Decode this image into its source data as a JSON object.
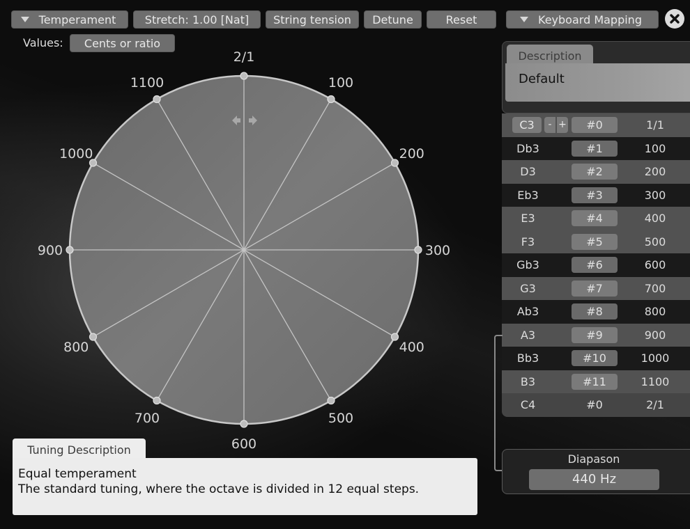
{
  "toolbar": {
    "temperament_label": "Temperament",
    "stretch_label": "Stretch: 1.00 [Nat]",
    "string_tension_label": "String tension",
    "detune_label": "Detune",
    "reset_label": "Reset",
    "keyboard_mapping_label": "Keyboard Mapping",
    "close_icon": "close-icon"
  },
  "values": {
    "label": "Values:",
    "mode": "Cents or ratio"
  },
  "chart_data": {
    "type": "radial-tuning-wheel",
    "title": "",
    "steps": 12,
    "unit": "cents",
    "range": [
      0,
      1200
    ],
    "points": [
      {
        "label": "2/1",
        "cents": 0
      },
      {
        "label": "100",
        "cents": 100
      },
      {
        "label": "200",
        "cents": 200
      },
      {
        "label": "300",
        "cents": 300
      },
      {
        "label": "400",
        "cents": 400
      },
      {
        "label": "500",
        "cents": 500
      },
      {
        "label": "600",
        "cents": 600
      },
      {
        "label": "700",
        "cents": 700
      },
      {
        "label": "800",
        "cents": 800
      },
      {
        "label": "900",
        "cents": 900
      },
      {
        "label": "1000",
        "cents": 1000
      },
      {
        "label": "1100",
        "cents": 1100
      }
    ],
    "rotate_handle_icon": "left-right-arrows-icon"
  },
  "description": {
    "tab_label": "Description",
    "value": "Default"
  },
  "mapping_table": {
    "rows": [
      {
        "note": "C3",
        "key": "#0",
        "value": "1/1",
        "shade": "light",
        "editable": true
      },
      {
        "note": "Db3",
        "key": "#1",
        "value": "100",
        "shade": "dark"
      },
      {
        "note": "D3",
        "key": "#2",
        "value": "200",
        "shade": "light"
      },
      {
        "note": "Eb3",
        "key": "#3",
        "value": "300",
        "shade": "dark"
      },
      {
        "note": "E3",
        "key": "#4",
        "value": "400",
        "shade": "light"
      },
      {
        "note": "F3",
        "key": "#5",
        "value": "500",
        "shade": "light"
      },
      {
        "note": "Gb3",
        "key": "#6",
        "value": "600",
        "shade": "dark"
      },
      {
        "note": "G3",
        "key": "#7",
        "value": "700",
        "shade": "light"
      },
      {
        "note": "Ab3",
        "key": "#8",
        "value": "800",
        "shade": "dark"
      },
      {
        "note": "A3",
        "key": "#9",
        "value": "900",
        "shade": "light"
      },
      {
        "note": "Bb3",
        "key": "#10",
        "value": "1000",
        "shade": "dark"
      },
      {
        "note": "B3",
        "key": "#11",
        "value": "1100",
        "shade": "light"
      },
      {
        "note": "C4",
        "key": "#0",
        "value": "2/1",
        "shade": "last",
        "plain": true
      }
    ],
    "minus_label": "-",
    "plus_label": "+"
  },
  "diapason": {
    "label": "Diapason",
    "value": "440 Hz"
  },
  "tuning_description": {
    "tab_label": "Tuning Description",
    "title": "Equal temperament",
    "text": "The standard tuning, where the octave is divided in 12 equal steps."
  }
}
